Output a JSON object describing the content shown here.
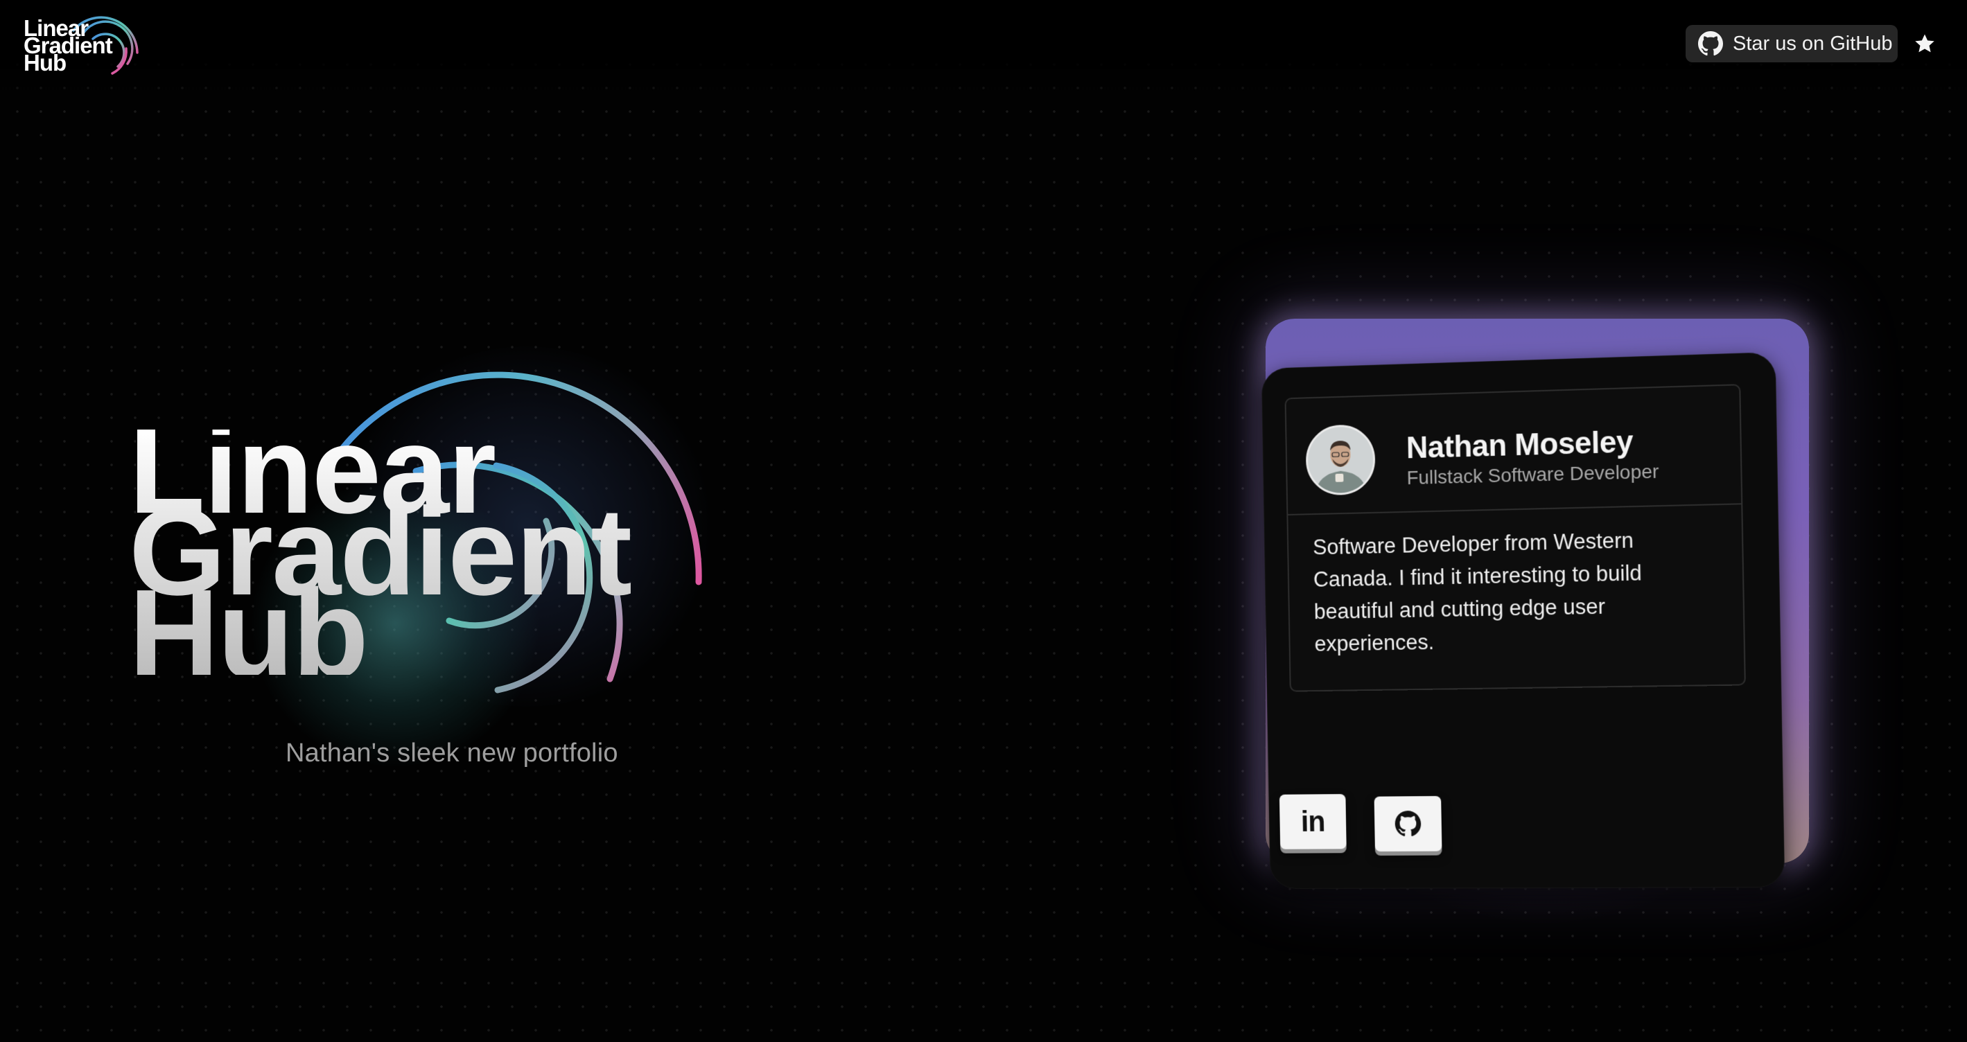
{
  "header": {
    "logo": {
      "lines": [
        "Linear",
        "Gradient",
        "Hub"
      ]
    },
    "github_button_label": "Star us on GitHub",
    "icons": {
      "github": "github-icon",
      "star": "star-icon"
    }
  },
  "hero": {
    "title_lines": [
      "Linear",
      "Gradient",
      "Hub"
    ],
    "tagline": "Nathan's sleek new portfolio",
    "arc_colors": [
      "#4a8fe0",
      "#5cc3b0",
      "#d95aa0"
    ]
  },
  "card": {
    "name": "Nathan Moseley",
    "role": "Fullstack Software Developer",
    "bio": "Software Developer from Western Canada. I find it interesting to build beautiful and cutting edge user experiences.",
    "socials": [
      {
        "label": "in",
        "icon": "linkedin-icon"
      },
      {
        "icon": "github-icon"
      }
    ],
    "accent_gradient": [
      "#6c5fb3",
      "#9f8585"
    ]
  }
}
